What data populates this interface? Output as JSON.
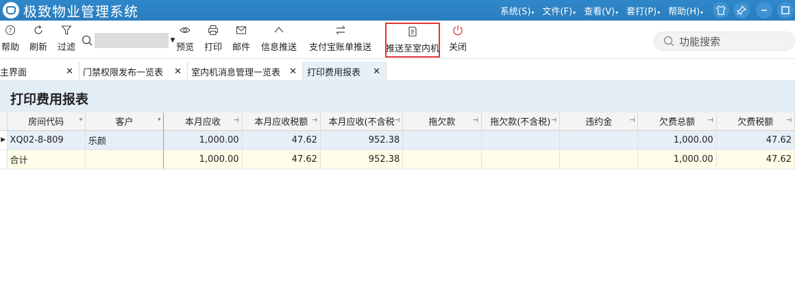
{
  "app": {
    "title": "极致物业管理系统",
    "menus": [
      "系统(S)",
      "文件(F)",
      "查看(V)",
      "套打(P)",
      "帮助(H)"
    ]
  },
  "toolbar": {
    "help": "帮助",
    "refresh": "刷新",
    "filter": "过滤",
    "search_value": "",
    "preview": "预览",
    "print": "打印",
    "mail": "邮件",
    "info_push": "信息推送",
    "alipay_push": "支付宝账单推送",
    "push_indoor": "推送至室内机",
    "close": "关闭",
    "function_search_placeholder": "功能搜索"
  },
  "tabs": [
    {
      "label": "主界面",
      "active": false
    },
    {
      "label": "门禁权限发布一览表",
      "active": false
    },
    {
      "label": "室内机消息管理一览表",
      "active": false
    },
    {
      "label": "打印费用报表",
      "active": true
    }
  ],
  "report": {
    "title": "打印费用报表",
    "columns": [
      "房间代码",
      "客户",
      "本月应收",
      "本月应收税额",
      "本月应收(不含税",
      "拖欠款",
      "拖欠款(不含税)",
      "违约金",
      "欠费总额",
      "欠费税额"
    ],
    "rows": [
      [
        "XQ02-8-809",
        "乐颜",
        "1,000.00",
        "47.62",
        "952.38",
        "",
        "",
        "",
        "1,000.00",
        "47.62"
      ]
    ],
    "total": [
      "合计",
      "",
      "1,000.00",
      "47.62",
      "952.38",
      "",
      "",
      "",
      "1,000.00",
      "47.62"
    ]
  },
  "colors": {
    "titlebar": "#2a7dbd",
    "highlight": "#e0333a",
    "selected_row": "#e6eff8",
    "total_row": "#fffde7"
  }
}
